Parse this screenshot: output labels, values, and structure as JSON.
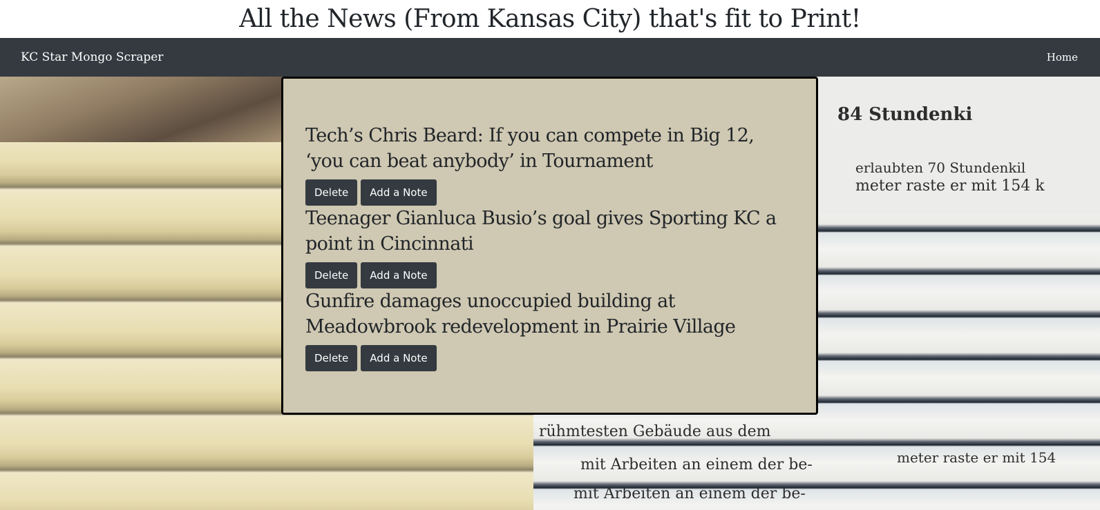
{
  "header": {
    "title": "All the News (From Kansas City) that's fit to Print!"
  },
  "navbar": {
    "brand": "KC Star Mongo Scraper",
    "home_link": "Home"
  },
  "articles": [
    {
      "headline": "Tech’s Chris Beard: If you can compete in Big 12, ‘you can beat anybody’ in Tournament",
      "delete_label": "Delete",
      "note_label": "Add a Note"
    },
    {
      "headline": "Teenager Gianluca Busio’s goal gives Sporting KC a point in Cincinnati",
      "delete_label": "Delete",
      "note_label": "Add a Note"
    },
    {
      "headline": "Gunfire damages unoccupied building at Meadowbrook redevelopment in Prairie Village",
      "delete_label": "Delete",
      "note_label": "Add a Note"
    }
  ],
  "background_text": [
    "84 Stundenki",
    "erlaubten 70 Stundenkil",
    "meter raste er mit 154 k",
    "rühmtesten Gebäude aus dem",
    "mit Arbeiten an einem der be-",
    "meter raste er mit 154"
  ],
  "colors": {
    "navbar": "#343a40",
    "card": "#cfc8b2",
    "button": "#343a40"
  }
}
